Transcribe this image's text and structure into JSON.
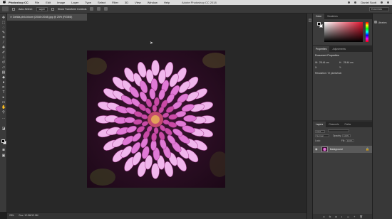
{
  "menubar": {
    "apple": "",
    "app_name": "Photoshop CC",
    "items": [
      "File",
      "Edit",
      "Image",
      "Layer",
      "Type",
      "Select",
      "Filter",
      "3D",
      "View",
      "Window",
      "Help"
    ],
    "window_title": "Adobe Photoshop CC 2018",
    "user": "Daniel Scott"
  },
  "options_bar": {
    "auto_select_label": "Auto-Select:",
    "layer_value": "Layer",
    "show_transform_label": "Show Transform Controls",
    "search_text": "Essentials"
  },
  "document_tab": {
    "label": "Dahlia-pink-bloom (2048×2048).jpg @ 25% (RGB/8)"
  },
  "statusbar": {
    "zoom": "25%",
    "doc_info": "Doc: 12.0M/12.0M"
  },
  "panels": {
    "color_tabs": [
      "Color",
      "Swatches"
    ],
    "properties_tabs": [
      "Properties",
      "Adjustments"
    ],
    "properties": {
      "title": "Document Properties",
      "w_label": "W:",
      "w_value": "28.44 cm",
      "h_label": "H:",
      "h_value": "28.44 cm",
      "x_label": "X:",
      "y_label": "Y:",
      "resolution": "Resolution: 72 pixels/inch"
    },
    "layers_tabs": [
      "Layers",
      "Channels",
      "Paths"
    ],
    "layers": {
      "kind_label": "Kind",
      "mode_value": "Normal",
      "opacity_label": "Opacity:",
      "opacity_value": "100%",
      "lock_label": "Lock:",
      "fill_label": "Fill:",
      "fill_value": "100%",
      "items": [
        {
          "name": "Background",
          "visible": true,
          "locked": true
        }
      ]
    },
    "libraries_label": "Libraries"
  },
  "colors": {
    "ui_dark": "#282828",
    "panel": "#3c3c3c",
    "selected_layer": "#5a5a5a",
    "flower_pink": "#e070d6",
    "color_picker_hue": "#e0142e"
  }
}
